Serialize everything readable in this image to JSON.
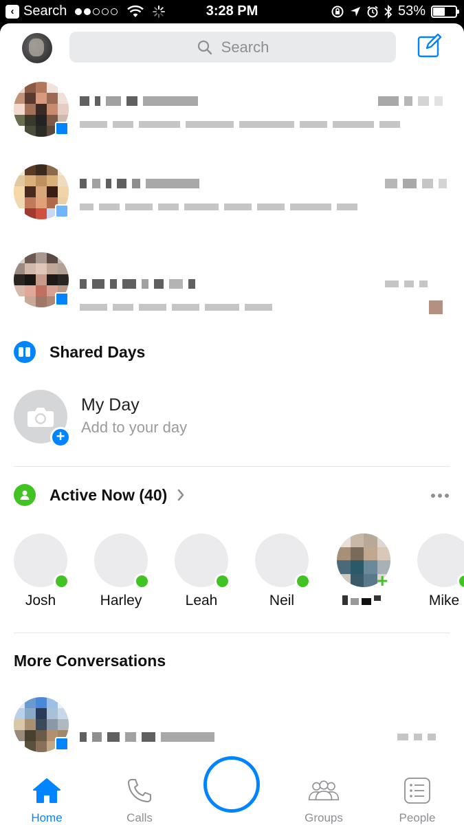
{
  "status_bar": {
    "back_app": "Search",
    "time": "3:28 PM",
    "battery": "53%",
    "battery_level": 0.53,
    "signal_bars_filled": 2,
    "signal_bars_total": 5
  },
  "header": {
    "search_placeholder": "Search",
    "compose_icon": "compose-icon",
    "avatar_icon": "profile-avatar"
  },
  "colors": {
    "accent": "#0084ff",
    "online": "#42c324"
  },
  "shared_days": {
    "title": "Shared Days",
    "my_day_title": "My Day",
    "my_day_subtitle": "Add to your day"
  },
  "active_now": {
    "title": "Active Now (40)",
    "people": [
      {
        "name": "Josh",
        "online": true
      },
      {
        "name": "Harley",
        "online": true
      },
      {
        "name": "Leah",
        "online": true
      },
      {
        "name": "Neil",
        "online": true
      },
      {
        "name": "",
        "online": true
      },
      {
        "name": "Mike",
        "online": true
      }
    ]
  },
  "more_conversations": {
    "title": "More Conversations"
  },
  "tabs": [
    {
      "label": "Home",
      "icon": "home-icon",
      "active": true
    },
    {
      "label": "Calls",
      "icon": "phone-icon",
      "active": false
    },
    {
      "label": "",
      "icon": "camera-button",
      "active": false
    },
    {
      "label": "Groups",
      "icon": "groups-icon",
      "active": false
    },
    {
      "label": "People",
      "icon": "people-list-icon",
      "active": false
    }
  ]
}
